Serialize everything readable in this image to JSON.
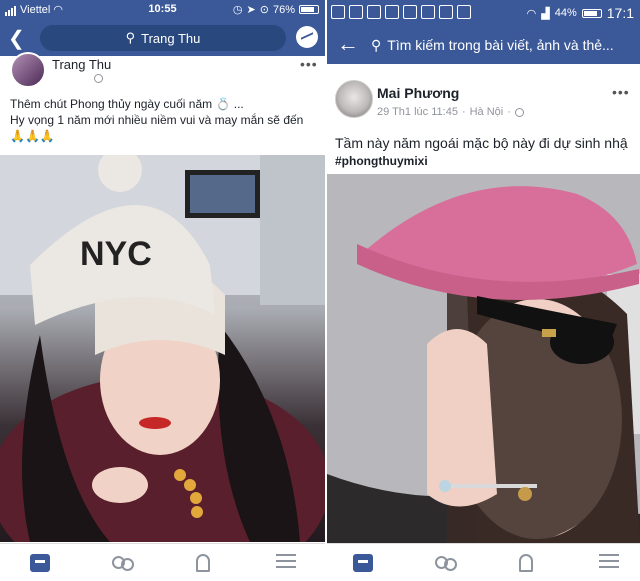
{
  "left": {
    "status": {
      "carrier": "Viettel",
      "time": "10:55",
      "battery": "76%"
    },
    "search_label": "Trang Thu",
    "post": {
      "author": "Trang Thu",
      "text_line1": "Thêm chút Phong thủy ngày cuối năm 💍 ...",
      "text_line2": "Hy vọng 1 năm mới nhiều niềm vui và may mắn sẽ đến",
      "text_line3": "🙏🙏🙏",
      "photo_hat_text": "NYC",
      "more": "•••"
    }
  },
  "right": {
    "status": {
      "battery": "44%",
      "time": "17:1"
    },
    "search_placeholder": "Tìm kiếm trong bài viết, ảnh và thẻ...",
    "post": {
      "author": "Mai Phương",
      "time": "29 Th1 lúc 11:45",
      "location": "Hà Nội",
      "text": "Tầm này năm ngoái mặc bộ này đi dự sinh nhậ",
      "hashtag": "#phongthuymixi",
      "more": "•••"
    }
  },
  "colors": {
    "brand": "#3b5998"
  }
}
